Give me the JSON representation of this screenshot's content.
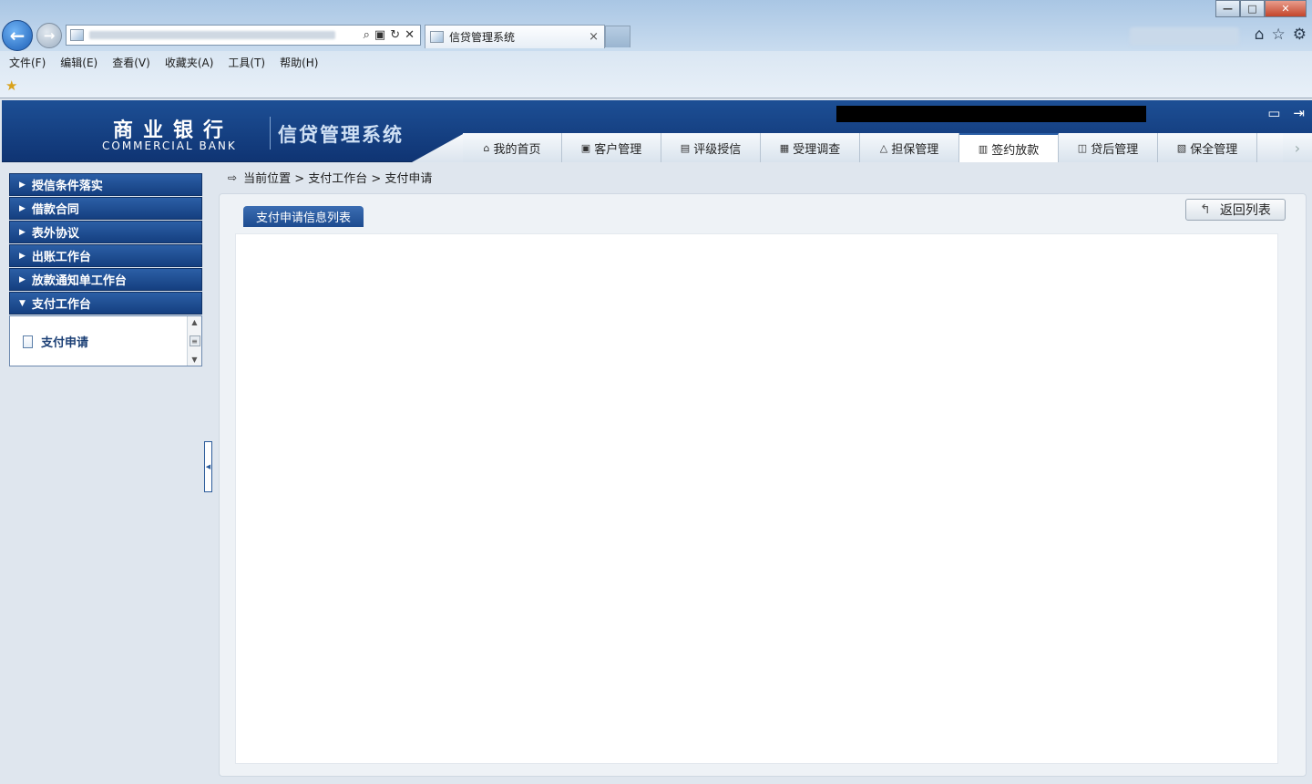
{
  "browser": {
    "tab_title": "信贷管理系统",
    "tab_close": "×",
    "menu": [
      "文件(F)",
      "编辑(E)",
      "查看(V)",
      "收藏夹(A)",
      "工具(T)",
      "帮助(H)"
    ],
    "window_controls": {
      "minimize": "—",
      "maximize": "□",
      "close": "✕"
    }
  },
  "app": {
    "logo_cn": "商业银行",
    "logo_en": "COMMERCIAL BANK",
    "system_name": "信贷管理系统",
    "nav_tabs": [
      {
        "label": "我的首页",
        "icon": "home-icon"
      },
      {
        "label": "客户管理",
        "icon": "customer-icon"
      },
      {
        "label": "评级授信",
        "icon": "rating-icon"
      },
      {
        "label": "受理调查",
        "icon": "survey-icon"
      },
      {
        "label": "担保管理",
        "icon": "guarantee-icon"
      },
      {
        "label": "签约放款",
        "icon": "contract-icon",
        "active": true
      },
      {
        "label": "贷后管理",
        "icon": "postloan-icon"
      },
      {
        "label": "保全管理",
        "icon": "preservation-icon"
      }
    ]
  },
  "sidebar": {
    "items": [
      {
        "label": "授信条件落实"
      },
      {
        "label": "借款合同"
      },
      {
        "label": "表外协议"
      },
      {
        "label": "出账工作台"
      },
      {
        "label": "放款通知单工作台"
      },
      {
        "label": "支付工作台",
        "expanded": true
      }
    ],
    "sub_item": "支付申请"
  },
  "breadcrumb": {
    "text": "当前位置 > 支付工作台 > 支付申请"
  },
  "main": {
    "list_tab": "支付申请信息列表",
    "return_button": "返回列表"
  }
}
